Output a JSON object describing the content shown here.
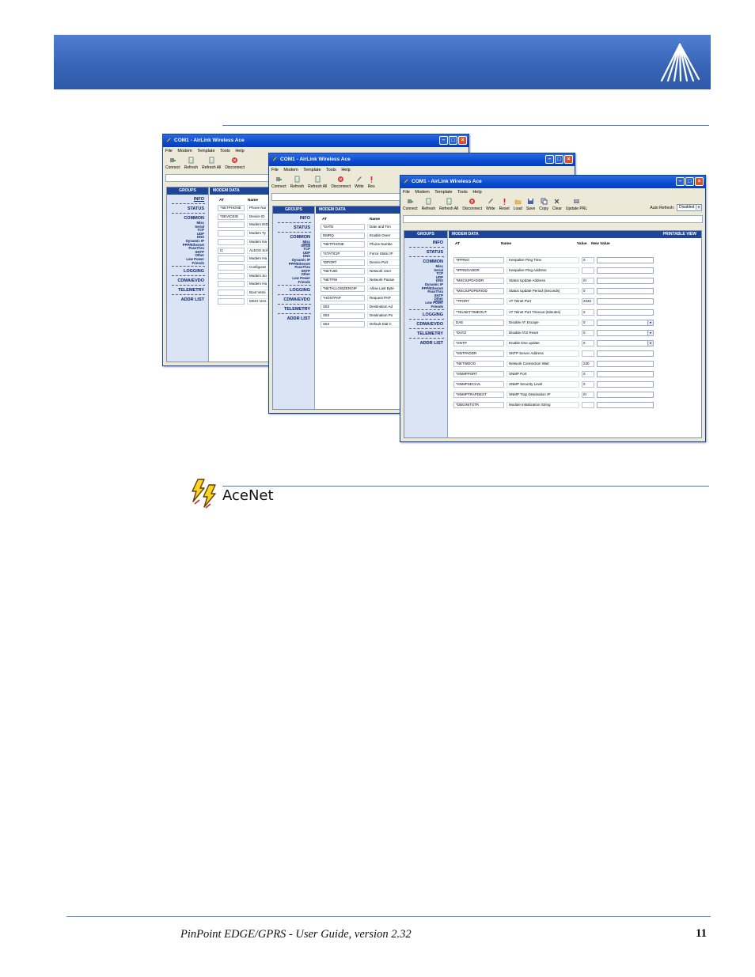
{
  "footer": {
    "text": "PinPoint EDGE/GPRS - User Guide, version 2.32",
    "page_number": "11"
  },
  "section": {
    "title": "AceNet"
  },
  "colors": {
    "banner": "#3865b8",
    "rule": "#4a7ab0",
    "group_header": "#1f4597",
    "group_panel": "#dbe4f5",
    "xp_title": "#0a4bd0"
  },
  "icons": {
    "banner_logo": "airlink-logo-icon",
    "section_icon": "lightning-bolt-icon"
  },
  "windows": [
    {
      "title": "COM1 - AirLink Wireless Ace",
      "menu": [
        "File",
        "Modem",
        "Template",
        "Tools",
        "Help"
      ],
      "tools": [
        "Connect",
        "Refresh",
        "Refresh All",
        "Disconnect"
      ],
      "groups_header": "GROUPS",
      "data_header": "MODEM DATA",
      "columns": [
        "AT",
        "Name"
      ],
      "groups": [
        {
          "label": "INFO"
        },
        {
          "label": "STATUS"
        },
        {
          "label": "COMMON",
          "subs": [
            "Misc",
            "Serial",
            "TCP",
            "UDP",
            "DNS",
            "Dynamic IP",
            "PPP/Ethernet",
            "PassThru",
            "SNTP",
            "Other",
            "Low Power",
            "Friends"
          ]
        },
        {
          "label": "LOGGING"
        },
        {
          "label": "CDMA/EVDO"
        },
        {
          "label": "TELEMETRY"
        },
        {
          "label": "ADDR LIST"
        }
      ],
      "rows": [
        {
          "at": "*NETPHONE",
          "name": "Phone Nur"
        },
        {
          "at": "*DEVICEID",
          "name": "Device ID"
        },
        {
          "at": "",
          "name": "Modem EID"
        },
        {
          "at": "",
          "name": "Modem Ty"
        },
        {
          "at": "",
          "name": "Modem Na"
        },
        {
          "at": "I1",
          "name": "ALEOS Sof"
        },
        {
          "at": "",
          "name": "Modem Ha"
        },
        {
          "at": "",
          "name": "Configurat"
        },
        {
          "at": "",
          "name": "Modem So"
        },
        {
          "at": "",
          "name": "Modem Ha"
        },
        {
          "at": "",
          "name": "Boot Versi"
        },
        {
          "at": "",
          "name": "MSCI Vers"
        }
      ]
    },
    {
      "title": "COM1 - AirLink Wireless Ace",
      "menu": [
        "File",
        "Modem",
        "Template",
        "Tools",
        "Help"
      ],
      "tools": [
        "Connect",
        "Refresh",
        "Refresh All",
        "Disconnect",
        "Write",
        "Res"
      ],
      "groups_header": "GROUPS",
      "data_header": "MODEM DATA",
      "columns": [
        "AT",
        "Name"
      ],
      "groups": [
        {
          "label": "INFO"
        },
        {
          "label": "STATUS"
        },
        {
          "label": "COMMON",
          "subs": [
            "Misc",
            "Serial",
            "TCP",
            "UDP",
            "DNS",
            "Dynamic IP",
            "PPP/Ethernet",
            "PassThru",
            "SNTP",
            "Other",
            "Low Power",
            "Friends"
          ]
        },
        {
          "label": "LOGGING"
        },
        {
          "label": "CDMA/EVDO"
        },
        {
          "label": "TELEMETRY"
        },
        {
          "label": "ADDR LIST"
        }
      ],
      "rows": [
        {
          "at": "*DATE",
          "name": "Date and Tim"
        },
        {
          "at": "DMRQ",
          "name": "Enable Overr"
        },
        {
          "at": "*NETPHONE",
          "name": "Phone Numbe"
        },
        {
          "at": "*STATICIP",
          "name": "Force Static IP"
        },
        {
          "at": "*DPORT",
          "name": "Device Port"
        },
        {
          "at": "*NETUID",
          "name": "Network User"
        },
        {
          "at": "*NETPW",
          "name": "Network Passw"
        },
        {
          "at": "*NETALLOWZEROIP",
          "name": "Allow Last Byte"
        },
        {
          "at": "*HOSTPAP",
          "name": "Request PAP"
        },
        {
          "at": "S53",
          "name": "Destination Ad"
        },
        {
          "at": "S53",
          "name": "Destination Po"
        },
        {
          "at": "S53",
          "name": "Default Dial C"
        }
      ]
    },
    {
      "title": "COM1 - AirLink Wireless Ace",
      "menu": [
        "File",
        "Modem",
        "Template",
        "Tools",
        "Help"
      ],
      "tools": [
        "Connect",
        "Refresh",
        "Refresh All",
        "Disconnect",
        "Write",
        "Reset",
        "Load",
        "Save",
        "Copy",
        "Clear",
        "Update PRL"
      ],
      "auto_refresh_label": "Auto Refresh:",
      "auto_refresh_value": "Disabled",
      "groups_header": "GROUPS",
      "data_header": "MODEM DATA",
      "printable_view": "PRINTABLE VIEW",
      "columns": [
        "AT",
        "Name",
        "Value",
        "New Value"
      ],
      "groups": [
        {
          "label": "INFO"
        },
        {
          "label": "STATUS"
        },
        {
          "label": "COMMON",
          "subs": [
            "Misc",
            "Serial",
            "TCP",
            "UDP",
            "DNS",
            "Dynamic IP",
            "PPP/Ethernet",
            "PassThru",
            "SNTP",
            "Other",
            "Low Power",
            "Friends"
          ]
        },
        {
          "label": "LOGGING"
        },
        {
          "label": "CDMA/EVDO"
        },
        {
          "label": "TELEMETRY"
        },
        {
          "label": "ADDR LIST"
        }
      ],
      "rows": [
        {
          "at": "*IPPING",
          "name": "Keepalive Ping Time",
          "value": "0",
          "dropdown": false
        },
        {
          "at": "*IPPINGADDR",
          "name": "Keepalive Ping Address",
          "value": "",
          "dropdown": false
        },
        {
          "at": "*MSCIUPDADDR",
          "name": "Status Update Address",
          "value": "/0",
          "dropdown": false
        },
        {
          "at": "*MSCIUPDPERIOD",
          "name": "Status Update Period (Seconds)",
          "value": "0",
          "dropdown": false
        },
        {
          "at": "*TPORT",
          "name": "AT Telnet Port",
          "value": "2332",
          "dropdown": false
        },
        {
          "at": "*TELNETTIMEOUT",
          "name": "AT Telnet Port Timeout (Minutes)",
          "value": "2",
          "dropdown": false
        },
        {
          "at": "DAE",
          "name": "Disable AT Escape",
          "value": "0",
          "dropdown": true
        },
        {
          "at": "*DATZ",
          "name": "Disable ATZ Reset",
          "value": "0",
          "dropdown": true
        },
        {
          "at": "*SNTP",
          "name": "Enable time update",
          "value": "0",
          "dropdown": true
        },
        {
          "at": "*SNTPADDR",
          "name": "SNTP Server Address",
          "value": "",
          "dropdown": false
        },
        {
          "at": "*NETWDOG",
          "name": "Network Connection Wait",
          "value": "240",
          "dropdown": false
        },
        {
          "at": "*SNMPPORT",
          "name": "SNMP Port",
          "value": "0",
          "dropdown": false
        },
        {
          "at": "*SNMPSECLVL",
          "name": "SNMP Security Level",
          "value": "0",
          "dropdown": false
        },
        {
          "at": "*SNMPTRAPDEST",
          "name": "SNMP Trap Destination IP",
          "value": "/0",
          "dropdown": false
        },
        {
          "at": "*DBGINITSTR",
          "name": "Module Initialization String",
          "value": "",
          "dropdown": false
        }
      ]
    }
  ]
}
